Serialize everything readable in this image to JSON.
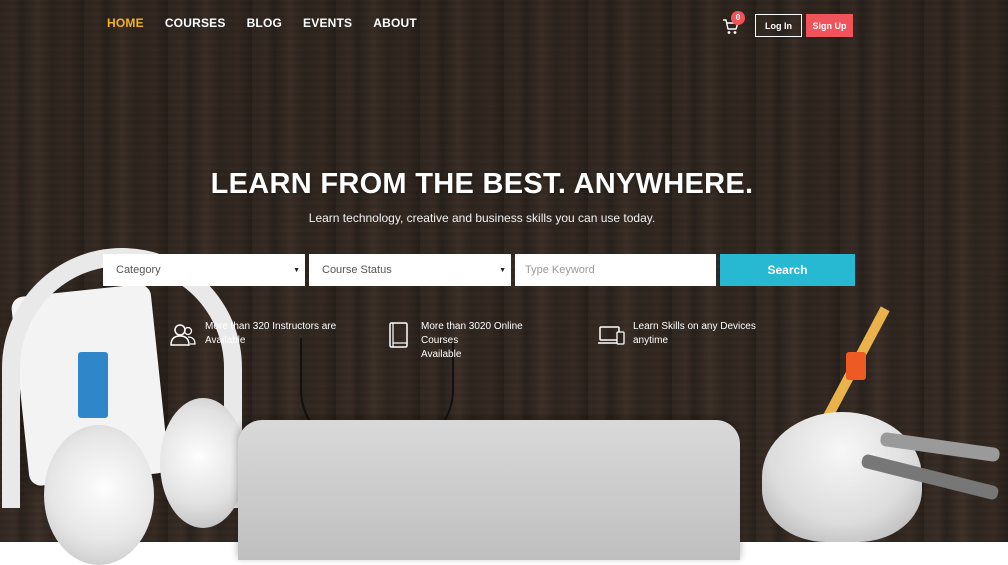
{
  "nav": {
    "items": [
      {
        "label": "HOME",
        "active": true
      },
      {
        "label": "COURSES",
        "active": false
      },
      {
        "label": "BLOG",
        "active": false
      },
      {
        "label": "EVENTS",
        "active": false
      },
      {
        "label": "ABOUT",
        "active": false
      }
    ]
  },
  "header": {
    "cart_count": "0",
    "login_label": "Log In",
    "signup_label": "Sign Up",
    "cart_icon": "cart-icon"
  },
  "hero": {
    "headline": "LEARN FROM THE BEST. ANYWHERE.",
    "subline": "Learn technology, creative and business skills you can use today."
  },
  "search": {
    "category": "Category",
    "course_status": "Course Status",
    "keyword_placeholder": "Type Keyword",
    "button_label": "Search"
  },
  "features": [
    {
      "icon": "instructors-icon",
      "line1": "More than 320 Instructors are",
      "line2": "Available"
    },
    {
      "icon": "book-icon",
      "line1": "More than 3020 Online Courses",
      "line2": "Available"
    },
    {
      "icon": "devices-icon",
      "line1": "Learn Skills on any Devices",
      "line2": "anytime"
    }
  ],
  "colors": {
    "accent_active": "#f4b22b",
    "signup": "#f0545a",
    "search_button": "#27b9d2"
  }
}
